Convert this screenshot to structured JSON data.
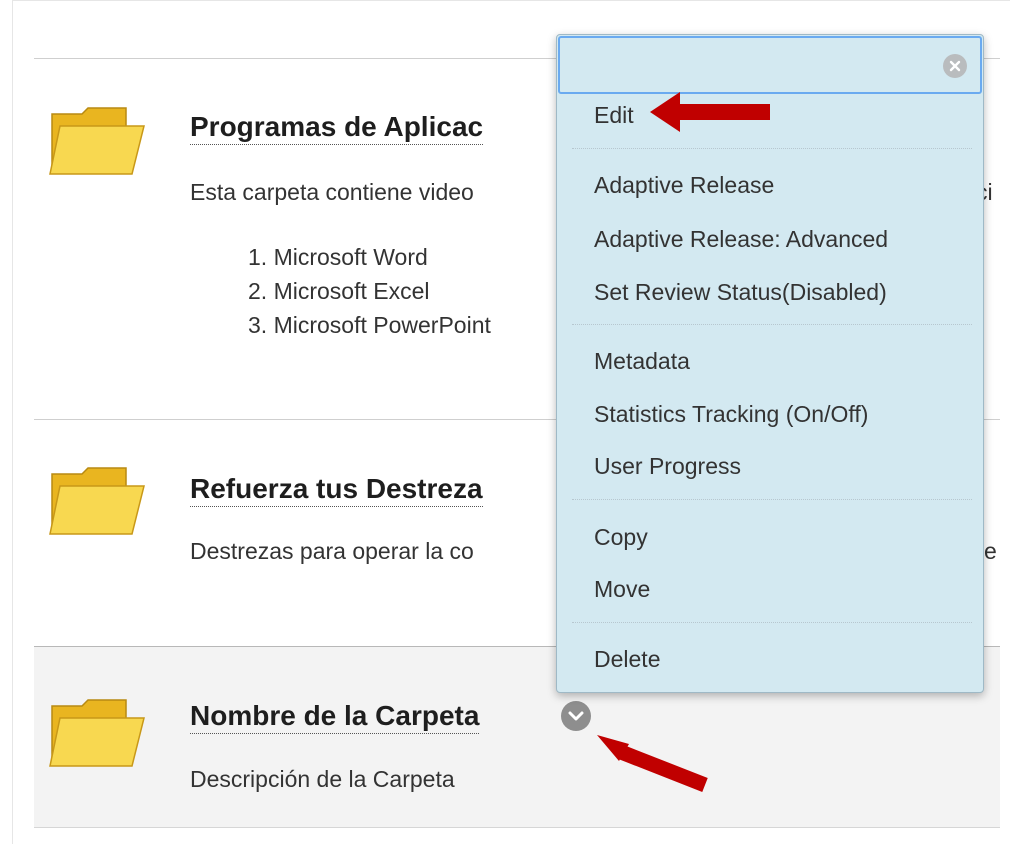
{
  "items": [
    {
      "title": "Programas de Aplicac",
      "description": "Esta carpeta contiene video",
      "description_tail": "ci",
      "list": [
        "1. Microsoft Word",
        "2. Microsoft Excel",
        "3. Microsoft PowerPoint"
      ]
    },
    {
      "title": "Refuerza tus Destreza",
      "description": "Destrezas para operar la co",
      "description_tail": "e"
    },
    {
      "title": "Nombre de la Carpeta",
      "description": "Descripción de la Carpeta"
    }
  ],
  "menu": {
    "search_value": "",
    "items": [
      "Edit",
      "Adaptive Release",
      "Adaptive Release: Advanced",
      "Set Review Status(Disabled)",
      "Metadata",
      "Statistics Tracking (On/Off)",
      "User Progress",
      "Copy",
      "Move",
      "Delete"
    ]
  },
  "colors": {
    "menu_bg": "#d3e9f1",
    "annotation_arrow": "#c00000",
    "folder_yellow": "#f3c735"
  }
}
